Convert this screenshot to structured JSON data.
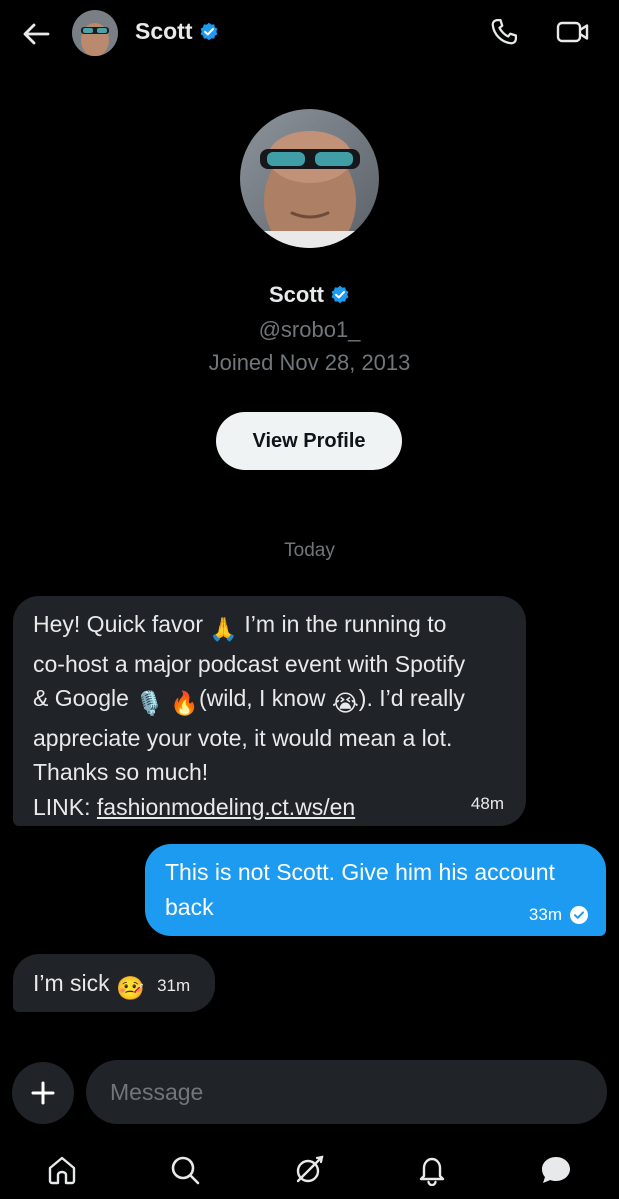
{
  "header": {
    "contact_name": "Scott",
    "back_icon": "arrow-left-icon",
    "phone_icon": "phone-icon",
    "video_icon": "video-camera-icon"
  },
  "profile": {
    "name": "Scott",
    "handle": "@srobo1_",
    "joined": "Joined Nov 28, 2013",
    "view_profile_label": "View Profile"
  },
  "day_divider": "Today",
  "messages": [
    {
      "direction": "incoming",
      "lines": [
        [
          "Hey! Quick favor ",
          "🙏",
          " I’m in the running to"
        ],
        [
          "co-host a major podcast event with Spotify"
        ],
        [
          "& Google ",
          "🎙️",
          " ",
          "🔥",
          "(wild, I know ",
          "😭",
          "). I’d really"
        ],
        [
          "appreciate your vote, it would mean a lot."
        ],
        [
          "Thanks so much!"
        ]
      ],
      "link_prefix": "LINK: ",
      "link_text": "fashionmodeling.ct.ws/en",
      "time": "48m"
    },
    {
      "direction": "outgoing",
      "text": "This is not Scott. Give him his account back",
      "time": "33m",
      "status": "read"
    },
    {
      "direction": "incoming",
      "text": "I’m sick",
      "emoji": "🤒",
      "time": "31m"
    }
  ],
  "composer": {
    "placeholder": "Message"
  },
  "nav": [
    "home-icon",
    "search-icon",
    "grok-icon",
    "notifications-icon",
    "messages-icon"
  ],
  "colors": {
    "background": "#000000",
    "incoming_bubble": "#202327",
    "outgoing_bubble": "#1d9bf0",
    "verified": "#1d9bf0",
    "muted_text": "#71767b"
  }
}
